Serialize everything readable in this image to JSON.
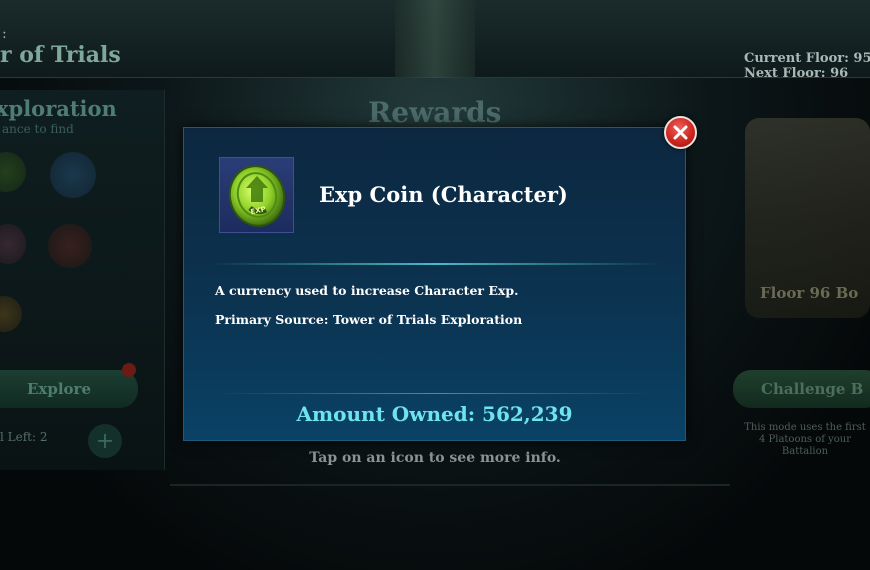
{
  "background": {
    "stage_colon": ":",
    "stage_title": "er of Trials",
    "current_floor": "Current Floor: 95",
    "next_floor": "Next Floor: 96",
    "exploration_title": "xploration",
    "exploration_sub": "ance to find",
    "explore_button": "Explore",
    "left_count": "l Left:  2",
    "rewards_title": "Rewards",
    "floor_card": "Floor 96 Bo",
    "challenge_button": "Challenge B",
    "challenge_note": "This mode uses the first 4 Platoons of your Battalion",
    "tap_hint": "Tap on an icon to see more info."
  },
  "modal": {
    "item_icon": "exp-coin-icon",
    "item_name": "Exp Coin (Character)",
    "description_1": "A currency used to increase Character Exp.",
    "description_2": "Primary Source: Tower of Trials Exploration",
    "amount_owned": "Amount Owned: 562,239",
    "close_icon": "close-icon"
  },
  "colors": {
    "modal_bg": "#0b3350",
    "amount_text": "#6fe3ee",
    "close_red": "#cf2620",
    "coin_green": "#8fd02a"
  }
}
